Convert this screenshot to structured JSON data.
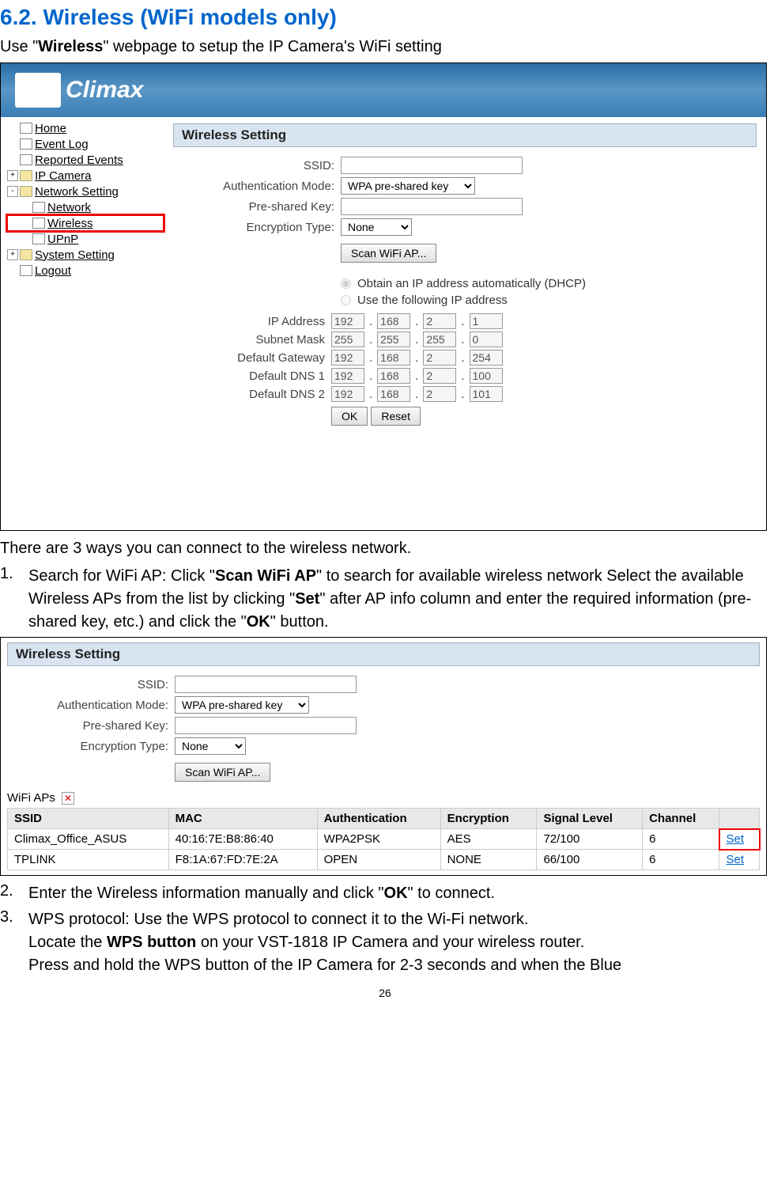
{
  "section": {
    "title": "6.2. Wireless (WiFi models only)",
    "intro_pre": "Use \"",
    "intro_bold": "Wireless",
    "intro_post": "\" webpage to setup the IP Camera's WiFi setting"
  },
  "logo_text": "Climax",
  "sidebar": {
    "items": [
      {
        "label": "Home",
        "type": "file"
      },
      {
        "label": "Event Log",
        "type": "file"
      },
      {
        "label": "Reported Events",
        "type": "file"
      },
      {
        "label": "IP Camera",
        "type": "folder",
        "expander": "+"
      },
      {
        "label": "Network Setting",
        "type": "folder",
        "expander": "-"
      },
      {
        "label": "Network",
        "type": "file",
        "indent": 1
      },
      {
        "label": "Wireless",
        "type": "file",
        "indent": 1,
        "highlight": true
      },
      {
        "label": "UPnP",
        "type": "file",
        "indent": 1
      },
      {
        "label": "System Setting",
        "type": "folder",
        "expander": "+"
      },
      {
        "label": "Logout",
        "type": "file"
      }
    ]
  },
  "panel": {
    "title": "Wireless Setting",
    "ssid_label": "SSID:",
    "auth_label": "Authentication Mode:",
    "auth_value": "WPA pre-shared key",
    "psk_label": "Pre-shared Key:",
    "enc_label": "Encryption Type:",
    "enc_value": "None",
    "scan_btn": "Scan WiFi AP...",
    "radio1": "Obtain an IP address automatically (DHCP)",
    "radio2": "Use the following IP address",
    "ip_label": "IP Address",
    "subnet_label": "Subnet Mask",
    "gateway_label": "Default Gateway",
    "dns1_label": "Default DNS 1",
    "dns2_label": "Default DNS 2",
    "ip_vals": [
      "192",
      "168",
      "2",
      "1"
    ],
    "subnet_vals": [
      "255",
      "255",
      "255",
      "0"
    ],
    "gateway_vals": [
      "192",
      "168",
      "2",
      "254"
    ],
    "dns1_vals": [
      "192",
      "168",
      "2",
      "100"
    ],
    "dns2_vals": [
      "192",
      "168",
      "2",
      "101"
    ],
    "ok_btn": "OK",
    "reset_btn": "Reset"
  },
  "mid_text": "There are 3 ways you can connect to the wireless network.",
  "step1": {
    "num": "1.",
    "line": "Search for WiFi AP: Click \"Scan WiFi AP\" to search for available wireless network Select the available Wireless APs from the list by clicking \"Set\" after AP info column and enter the required information (pre-shared key, etc.) and click the \"OK\" button."
  },
  "aps_label": "WiFi APs",
  "table": {
    "headers": [
      "SSID",
      "MAC",
      "Authentication",
      "Encryption",
      "Signal Level",
      "Channel",
      ""
    ],
    "rows": [
      [
        "Climax_Office_ASUS",
        "40:16:7E:B8:86:40",
        "WPA2PSK",
        "AES",
        "72/100",
        "6",
        "Set"
      ],
      [
        "TPLINK",
        "F8:1A:67:FD:7E:2A",
        "OPEN",
        "NONE",
        "66/100",
        "6",
        "Set"
      ]
    ]
  },
  "step2": {
    "num": "2.",
    "line": "Enter the Wireless information manually and click \"OK\" to connect."
  },
  "step3": {
    "num": "3.",
    "line1": "WPS protocol: Use the WPS protocol to connect it to the Wi-Fi network.",
    "line2_pre": "Locate the ",
    "line2_bold": "WPS button",
    "line2_post": " on your VST-1818 IP Camera and your wireless router.",
    "line3": "Press and hold the WPS button of the IP Camera for 2-3 seconds and when the Blue"
  },
  "page_num": "26"
}
